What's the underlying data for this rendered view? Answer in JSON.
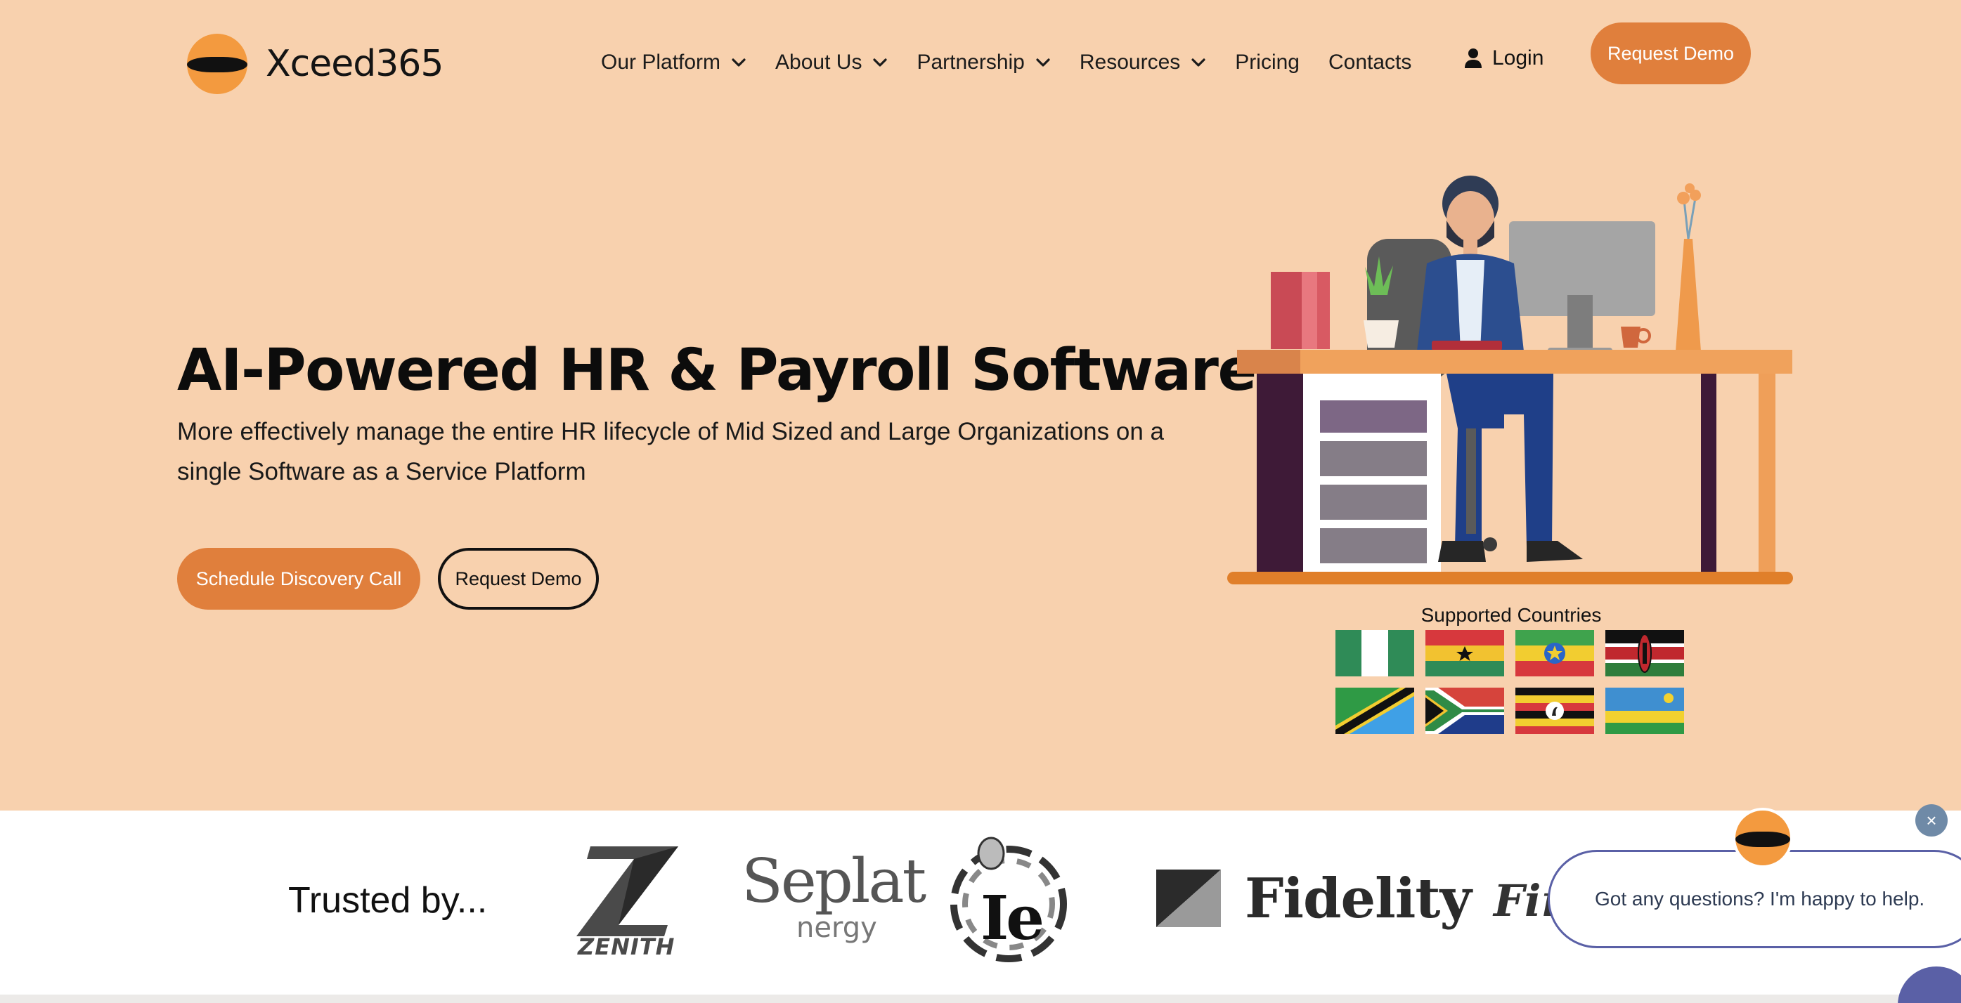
{
  "brand": {
    "name": "Xceed365",
    "accent": "#e07f3c",
    "background": "#f8d1ae"
  },
  "nav": {
    "items": [
      {
        "label": "Our Platform",
        "has_dropdown": true
      },
      {
        "label": "About Us",
        "has_dropdown": true
      },
      {
        "label": "Partnership",
        "has_dropdown": true
      },
      {
        "label": "Resources",
        "has_dropdown": true
      },
      {
        "label": "Pricing",
        "has_dropdown": false
      },
      {
        "label": "Contacts",
        "has_dropdown": false
      }
    ],
    "login_label": "Login",
    "login_icon": "user-icon",
    "request_demo_label": "Request Demo"
  },
  "hero": {
    "title": "AI-Powered HR & Payroll Software",
    "subtitle": "More effectively manage the entire HR lifecycle of Mid Sized and Large Organizations on a single Software as a Service Platform",
    "primary_cta": "Schedule Discovery Call",
    "secondary_cta": "Request Demo"
  },
  "countries": {
    "label": "Supported Countries",
    "flags": [
      "nigeria-flag",
      "ghana-flag",
      "ethiopia-flag",
      "kenya-flag",
      "tanzania-flag",
      "south-africa-flag",
      "uganda-flag",
      "rwanda-flag"
    ]
  },
  "trusted": {
    "label": "Trusted by...",
    "partners": [
      {
        "logo": "zenith-logo",
        "text": "ZENITH"
      },
      {
        "logo": "seplat-logo",
        "text": "Seplat",
        "subtext": "nergy"
      },
      {
        "logo": "ie-logo",
        "text": "Ie"
      },
      {
        "logo": "fidelity-logo",
        "text": "Fidelity"
      },
      {
        "logo": "firstbank-logo",
        "text": "Firs"
      }
    ]
  },
  "chat": {
    "message": "Got any questions? I'm happy to help.",
    "close_symbol": "×"
  }
}
